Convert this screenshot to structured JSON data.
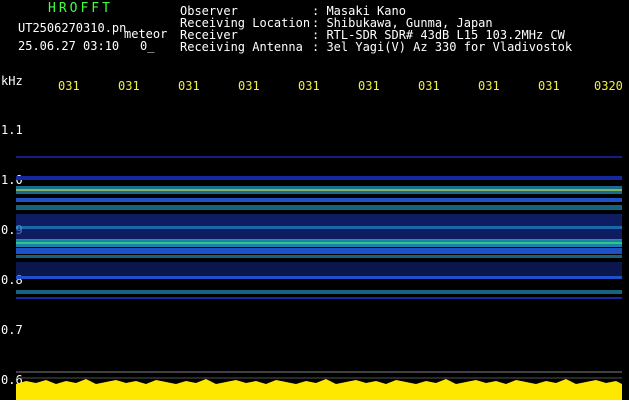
{
  "header": {
    "logo": "HROFFT",
    "file_name": "UT2506270310.pn",
    "file_suffix": "meteor",
    "timestamp": "25.06.27 03:10",
    "timestamp_tail": "0_"
  },
  "info": [
    {
      "label": "Observer",
      "value": ": Masaki Kano"
    },
    {
      "label": "Receiving Location",
      "value": ": Shibukawa, Gunma, Japan"
    },
    {
      "label": "Receiver",
      "value": ": RTL-SDR SDR# 43dB L15 103.2MHz CW"
    },
    {
      "label": "Receiving Antenna",
      "value": ": 3el Yagi(V) Az 330 for Vladivostok"
    }
  ],
  "axis": {
    "y_unit": "kHz",
    "y_ticks": [
      "1.1",
      "1.0",
      "0.9",
      "0.8",
      "0.7",
      "0.6"
    ],
    "x_ticks": [
      "031",
      "031",
      "031",
      "031",
      "031",
      "031",
      "031",
      "031",
      "031",
      "0320"
    ]
  },
  "colors": {
    "background": "#000000",
    "text_yellow": "#f0f040",
    "text_cyan": "#00c8ff",
    "signal_low": "#1428a0",
    "signal_mid": "#28c8ff",
    "signal_high": "#f0f040",
    "noise_floor": "#ffe800"
  }
}
